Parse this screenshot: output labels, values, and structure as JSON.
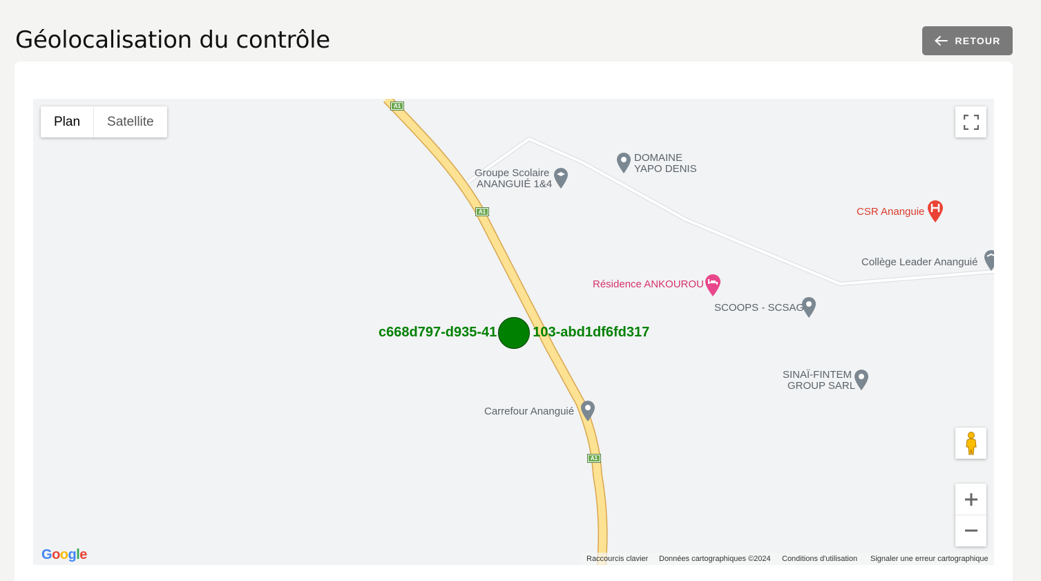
{
  "page": {
    "title": "Géolocalisation du contrôle",
    "back_label": "RETOUR"
  },
  "map": {
    "map_types": [
      "Plan",
      "Satellite"
    ],
    "active_type": "Plan",
    "marker": {
      "label": "c668d797-d935-41",
      "label_end": "103-abd1df6fd317",
      "color": "#008000"
    },
    "road_shield": "A1",
    "pois": {
      "groupe_scolaire_1": "Groupe Scolaire",
      "groupe_scolaire_2": "ANANGUIÉ 1&4",
      "domaine_1": "DOMAINE",
      "domaine_2": "YAPO DENIS",
      "csr": "CSR Ananguie",
      "college": "Collège Leader Ananguié",
      "residence": "Résidence ANKOUROU",
      "scoops": "SCOOPS - SCSAG",
      "sinai_1": "SINAÏ-FINTEM",
      "sinai_2": "GROUP SARL",
      "carrefour": "Carrefour Ananguié"
    },
    "google_logo": "Google",
    "attribution": {
      "shortcuts": "Raccourcis clavier",
      "data": "Données cartographiques ©2024",
      "terms": "Conditions d'utilisation",
      "report": "Signaler une erreur cartographique"
    }
  }
}
